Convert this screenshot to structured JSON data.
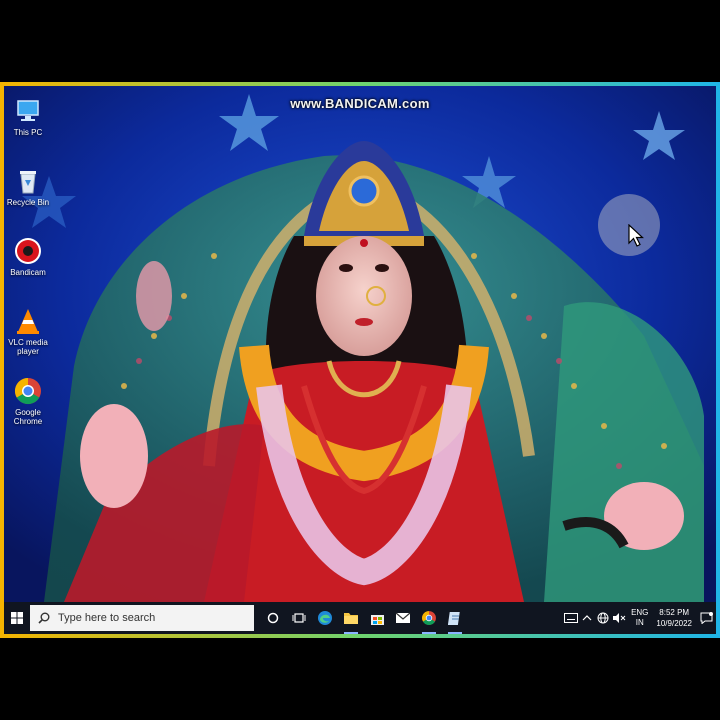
{
  "watermark": "www.BANDICAM.com",
  "desktop_icons": [
    {
      "label": "This PC",
      "icon": "this-pc-icon"
    },
    {
      "label": "Recycle Bin",
      "icon": "recycle-bin-icon"
    },
    {
      "label": "Bandicam",
      "icon": "bandicam-icon"
    },
    {
      "label": "VLC media player",
      "icon": "vlc-icon"
    },
    {
      "label": "Google Chrome",
      "icon": "chrome-icon"
    }
  ],
  "taskbar": {
    "search_placeholder": "Type here to search",
    "apps": [
      "cortana-icon",
      "task-view-icon",
      "edge-icon",
      "file-explorer-icon",
      "store-icon",
      "mail-icon",
      "chrome-icon",
      "notepad-icon"
    ]
  },
  "tray": {
    "lang_top": "ENG",
    "lang_bottom": "IN",
    "time": "8:52 PM",
    "date": "10/9/2022"
  },
  "colors": {
    "frame_gradient": [
      "#f5b400",
      "#6fd36f",
      "#1fb5e8"
    ],
    "taskbar": "#101520"
  }
}
